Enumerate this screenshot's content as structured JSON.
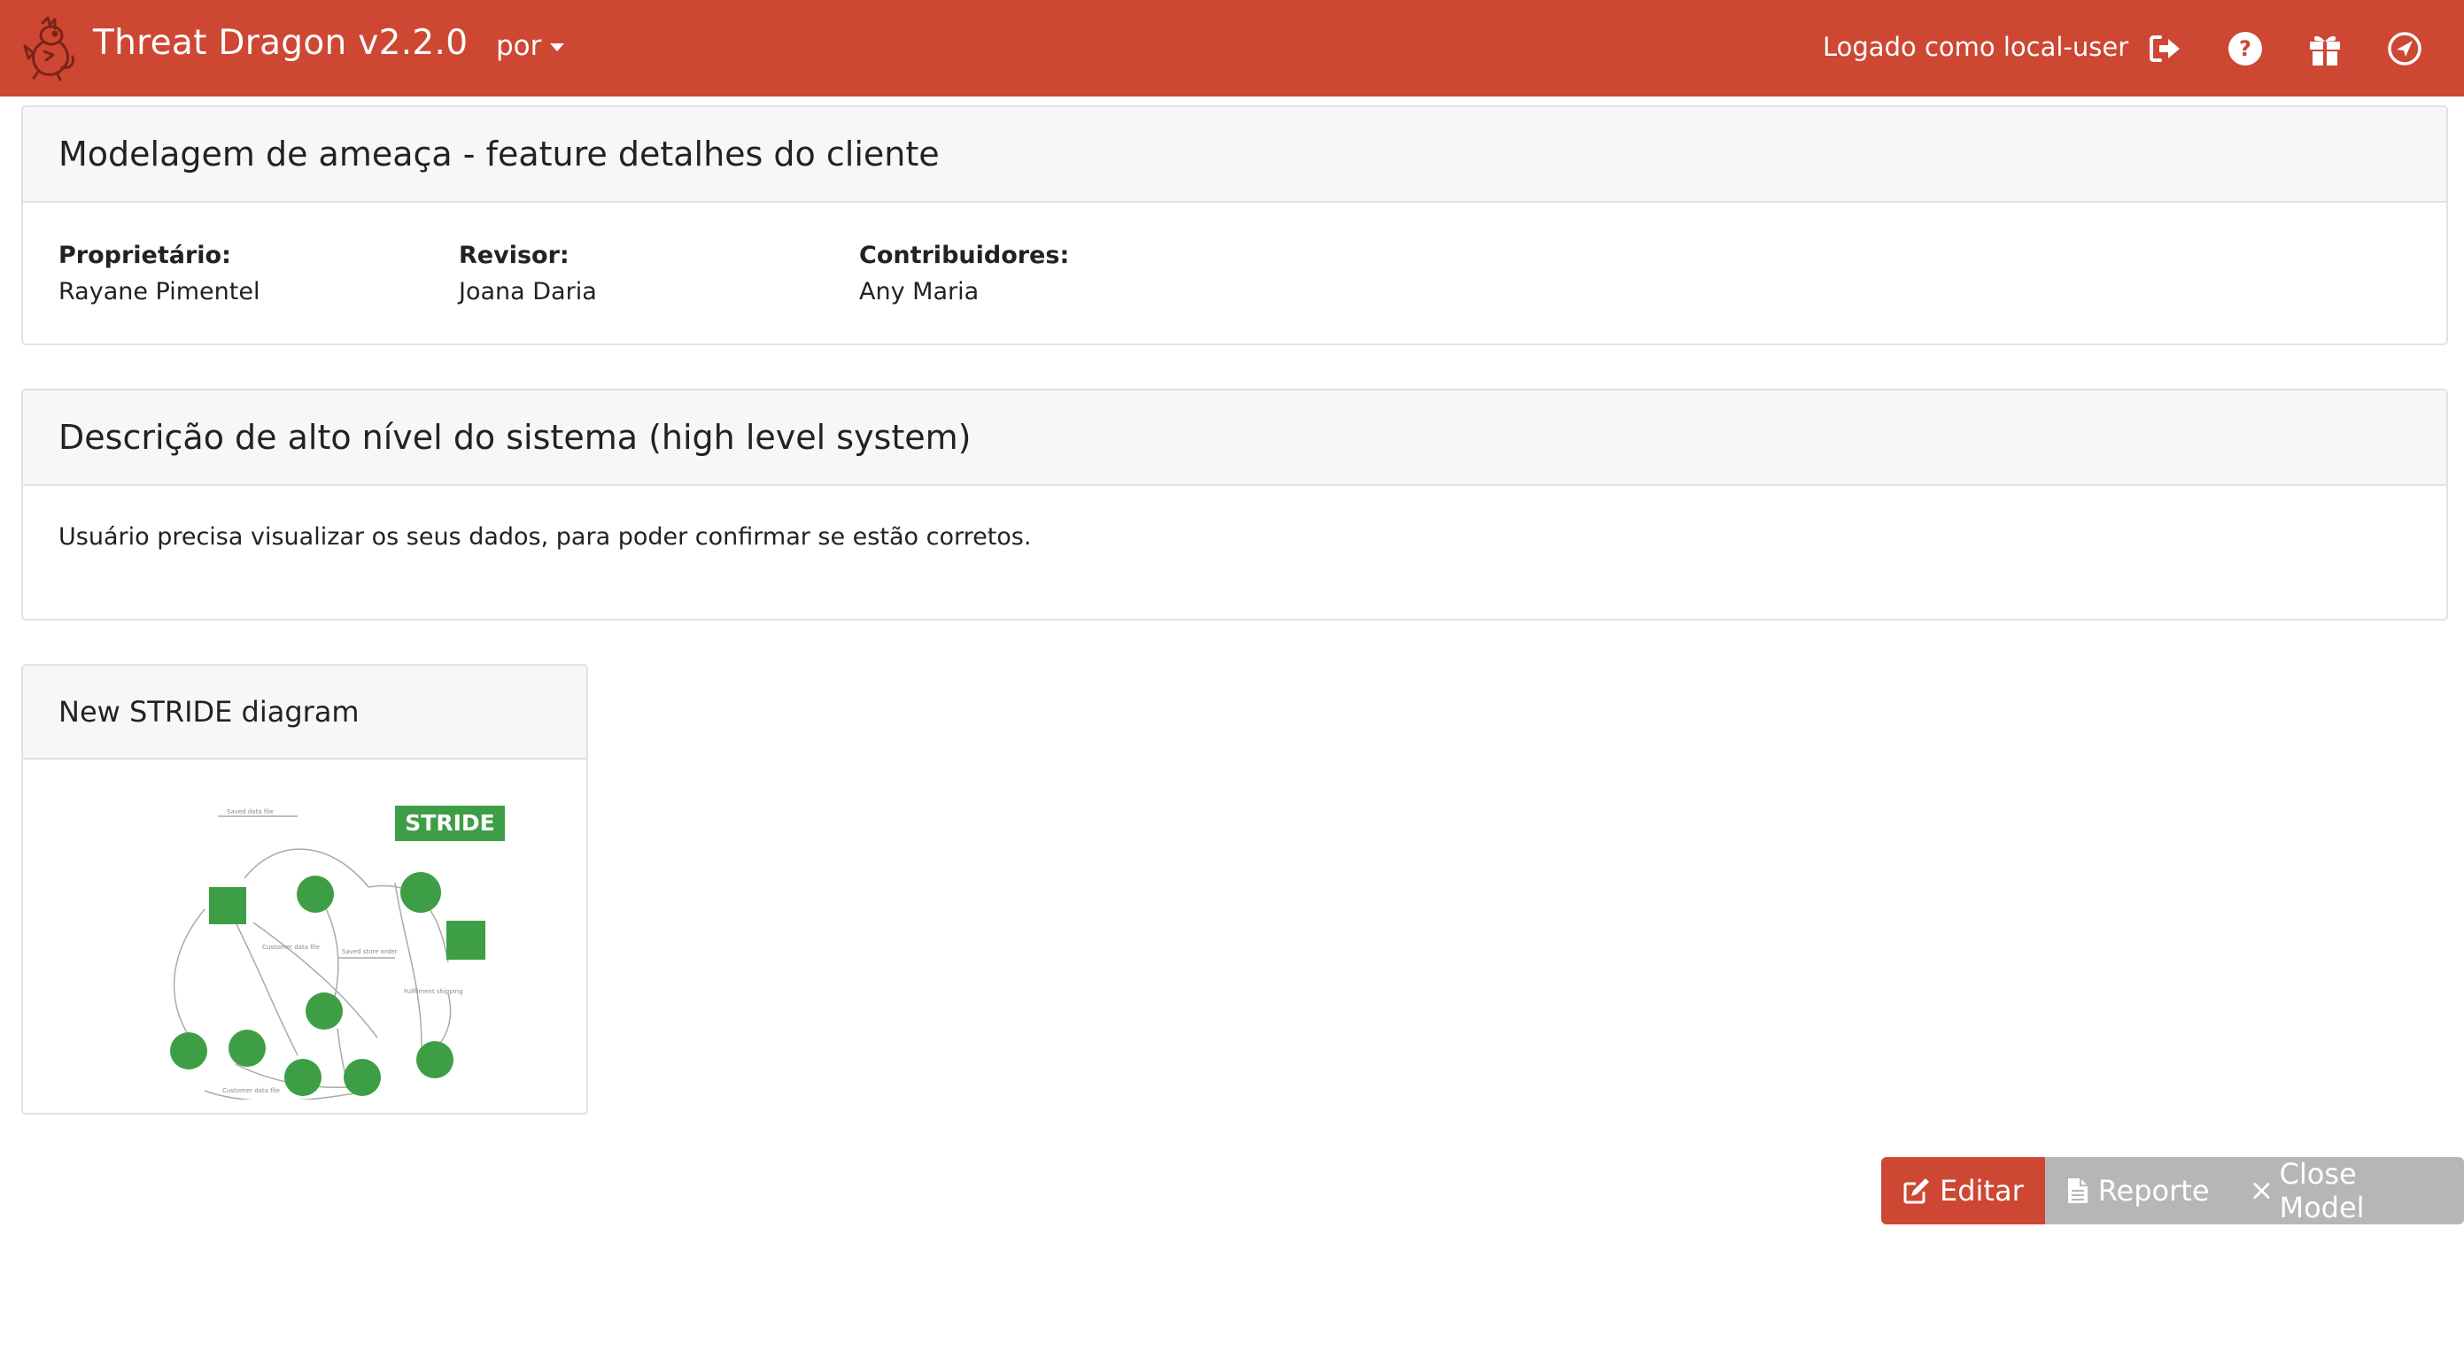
{
  "navbar": {
    "title": "Threat Dragon v2.2.0",
    "language": "por",
    "logged_in_text": "Logado como local-user",
    "icons": [
      "logout-icon",
      "help-icon",
      "gift-icon",
      "about-icon"
    ],
    "color": "#cd4733"
  },
  "model": {
    "title": "Modelagem de ameaça - feature detalhes do cliente",
    "owner_label": "Proprietário:",
    "owner": "Rayane Pimentel",
    "reviewer_label": "Revisor:",
    "reviewer": "Joana Daria",
    "contributors_label": "Contribuidores:",
    "contributors": "Any Maria"
  },
  "description": {
    "title": "Descrição de alto nível do sistema (high level system)",
    "text": "Usuário precisa visualizar os seus dados, para poder confirmar se estão corretos."
  },
  "diagram": {
    "title": "New STRIDE diagram",
    "thumbnail_badge": "STRIDE",
    "thumbnail_color": "#3e9e45"
  },
  "actions": {
    "edit": "Editar",
    "report": "Reporte",
    "close": "Close Model"
  }
}
